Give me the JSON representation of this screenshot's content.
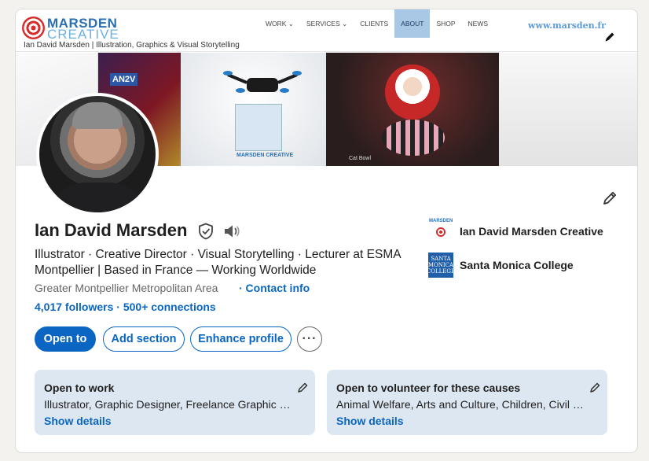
{
  "banner": {
    "logo_line1": "MARSDEN",
    "logo_line2": "CREATIVE",
    "tagline": "Ian David Marsden | Illustration, Graphics & Visual Storytelling",
    "nav": [
      "WORK ⌄",
      "SERVICES ⌄",
      "CLIENTS",
      "ABOUT",
      "SHOP",
      "NEWS"
    ],
    "nav_active": "ABOUT",
    "url": "www.marsden.fr",
    "badge_an2v": "AN2V",
    "box_label": "MARSDEN CREATIVE",
    "cat_bowl_label": "Cat Bowl"
  },
  "profile": {
    "name": "Ian David Marsden",
    "headline": "Illustrator · Creative Director · Visual Storytelling · Lecturer at ESMA Montpellier | Based in France — Working Worldwide",
    "location": "Greater Montpellier Metropolitan Area",
    "contact_label": "· Contact info",
    "followers": "4,017 followers",
    "connections": "500+ connections",
    "stats_separator": " · "
  },
  "actions": {
    "open_to": "Open to",
    "add_section": "Add section",
    "enhance_profile": "Enhance profile",
    "more": "···"
  },
  "organizations": [
    {
      "name": "Ian David Marsden Creative",
      "logo_text": "MARSDEN"
    },
    {
      "name": "Santa Monica College",
      "logo_text": "SANTA MONICA COLLEGE"
    }
  ],
  "panels": [
    {
      "title": "Open to work",
      "text": "Illustrator, Graphic Designer, Freelance Graphic Designer",
      "link": "Show details"
    },
    {
      "title": "Open to volunteer for these causes",
      "text": "Animal Welfare, Arts and Culture, Children, Civil Rights",
      "link": "Show details"
    }
  ],
  "colors": {
    "accent": "#0a66c2",
    "panel_bg": "#dde7f1",
    "page_bg": "#f4f2ee"
  },
  "icons": {
    "verified": "shield-check-icon",
    "pronunciation": "speaker-icon",
    "edit": "pencil-icon"
  }
}
